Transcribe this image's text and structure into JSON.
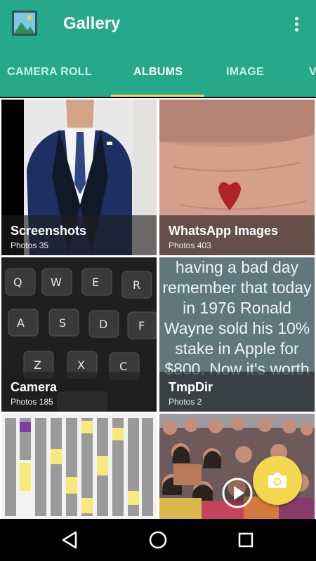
{
  "app": {
    "title": "Gallery"
  },
  "tabs": [
    {
      "label": "CAMERA ROLL",
      "active": false
    },
    {
      "label": "ALBUMS",
      "active": true
    },
    {
      "label": "IMAGE",
      "active": false
    },
    {
      "label": "V",
      "active": false
    }
  ],
  "albums": [
    {
      "name": "Screenshots",
      "count": "Photos 35"
    },
    {
      "name": "WhatsApp Images",
      "count": "Photos 403"
    },
    {
      "name": "Camera",
      "count": "Photos 185"
    },
    {
      "name": "TmpDir",
      "count": "Photos 2"
    }
  ],
  "thumbnails": {
    "tmpdir_text": "having a bad day remember that today in 1976 Ronald Wayne sold his 10% stake in Apple for $800. Now it's worth",
    "keyboard_keys": [
      "Q",
      "W",
      "E",
      "R",
      "A",
      "S",
      "D",
      "F",
      "Z",
      "X",
      "C"
    ]
  },
  "icons": {
    "app": "gallery-icon",
    "menu": "more-vert-icon",
    "fab": "camera-icon",
    "play": "play-icon",
    "nav": [
      "back-icon",
      "home-icon",
      "recents-icon"
    ]
  },
  "colors": {
    "primary": "#26a88a",
    "accent": "#f3d84d",
    "tab_inactive": "#c8f0e4"
  }
}
